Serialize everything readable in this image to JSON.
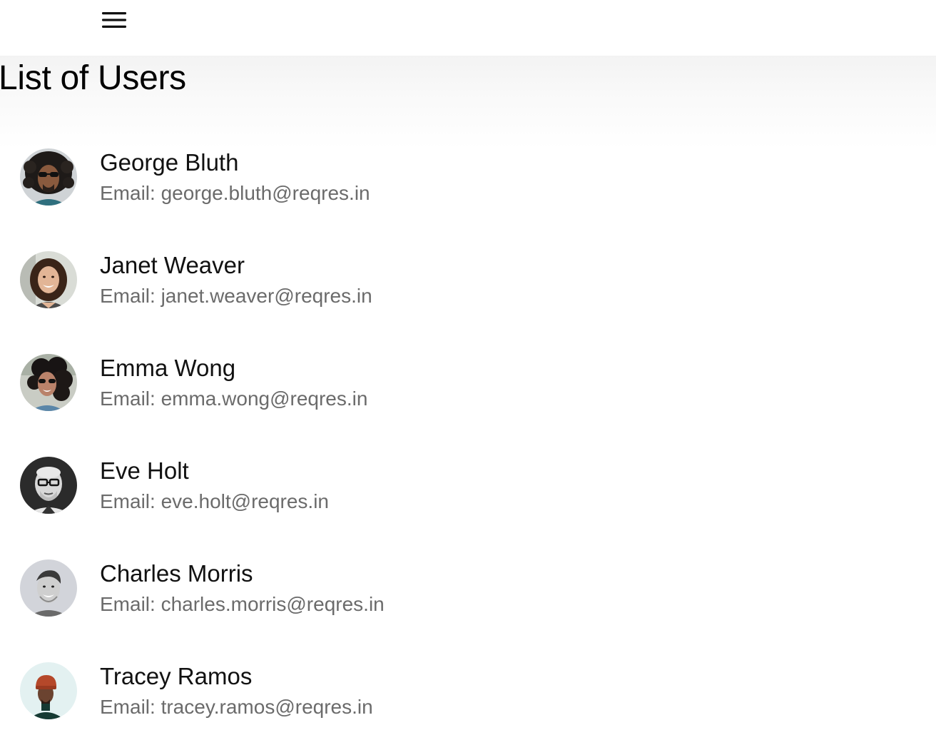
{
  "header": {
    "menu_icon": "hamburger-menu-icon"
  },
  "page": {
    "title": "List of Users"
  },
  "users": [
    {
      "name": "George Bluth",
      "email": "Email: george.bluth@reqres.in",
      "avatar_icon": "avatar-george-bluth"
    },
    {
      "name": "Janet Weaver",
      "email": "Email: janet.weaver@reqres.in",
      "avatar_icon": "avatar-janet-weaver"
    },
    {
      "name": "Emma Wong",
      "email": "Email: emma.wong@reqres.in",
      "avatar_icon": "avatar-emma-wong"
    },
    {
      "name": "Eve Holt",
      "email": "Email: eve.holt@reqres.in",
      "avatar_icon": "avatar-eve-holt"
    },
    {
      "name": "Charles Morris",
      "email": "Email: charles.morris@reqres.in",
      "avatar_icon": "avatar-charles-morris"
    },
    {
      "name": "Tracey Ramos",
      "email": "Email: tracey.ramos@reqres.in",
      "avatar_icon": "avatar-tracey-ramos"
    }
  ],
  "colors": {
    "text_primary": "#111111",
    "text_secondary": "#6b6b6b",
    "background": "#ffffff"
  }
}
